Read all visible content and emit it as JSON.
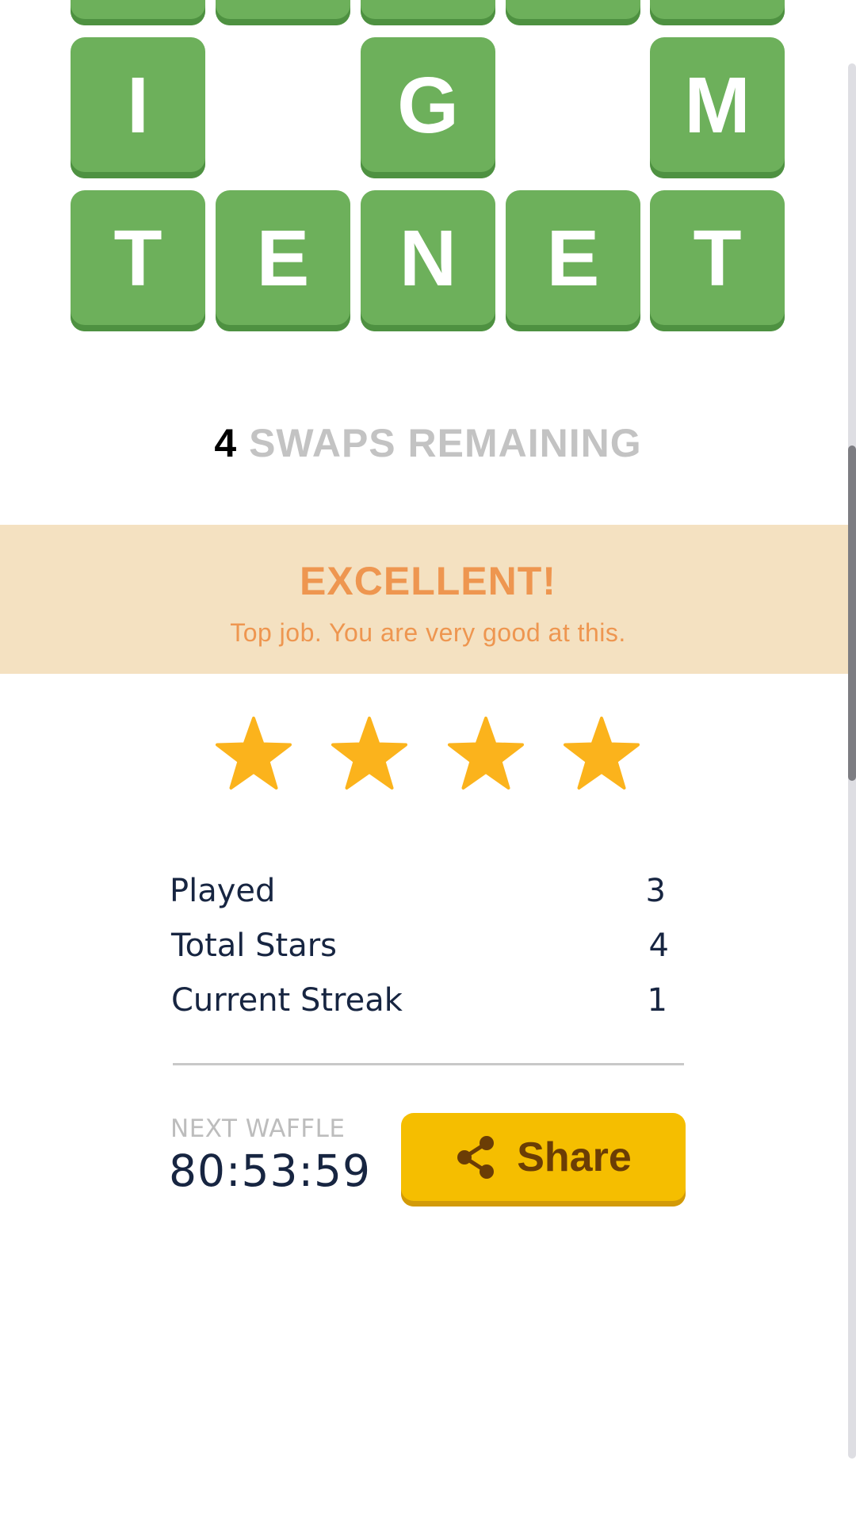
{
  "board": {
    "partial_row": [
      "",
      "",
      "",
      "",
      ""
    ],
    "row_2": [
      "I",
      "",
      "G",
      "",
      "M"
    ],
    "row_3": [
      "T",
      "E",
      "N",
      "E",
      "T"
    ]
  },
  "swaps": {
    "count": "4",
    "label": "SWAPS REMAINING"
  },
  "result": {
    "headline": "EXCELLENT!",
    "message": "Top job. You are very good at this."
  },
  "stars": {
    "earned": 4,
    "color": "#fbb31c"
  },
  "stats": [
    {
      "label": "Played",
      "value": "3"
    },
    {
      "label": "Total Stars",
      "value": "4"
    },
    {
      "label": "Current Streak",
      "value": "1"
    }
  ],
  "next_waffle": {
    "label": "NEXT WAFFLE",
    "countdown": "80:53:59"
  },
  "share": {
    "label": "Share",
    "icon": "share-icon"
  },
  "colors": {
    "tile_green": "#6db05b",
    "banner_bg": "#f4e1c1",
    "banner_text": "#ee9650",
    "share_bg": "#f5be00",
    "text_dark": "#172541"
  }
}
